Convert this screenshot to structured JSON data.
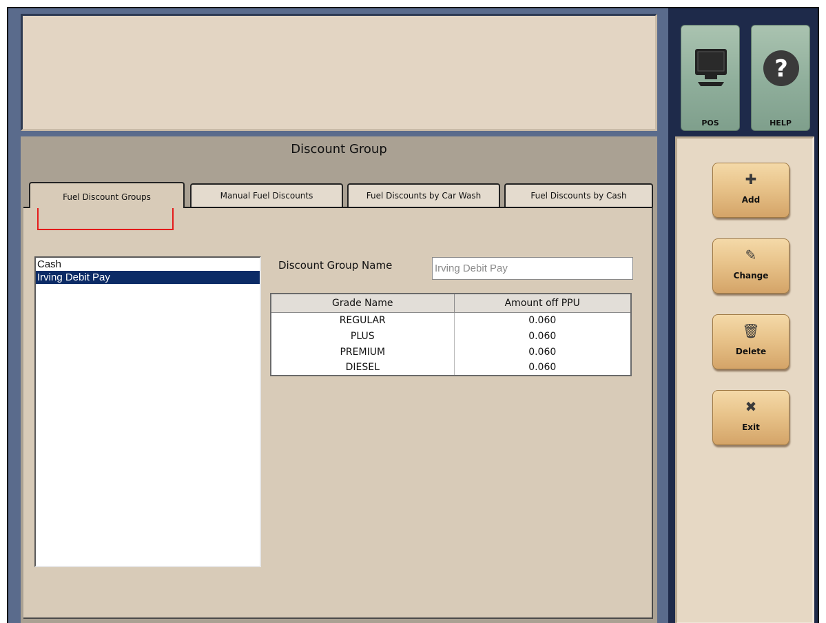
{
  "top_buttons": {
    "pos_label": "POS",
    "help_label": "HELP"
  },
  "page_title": "Discount Group",
  "tabs": [
    {
      "label": "Fuel Discount Groups",
      "active": true
    },
    {
      "label": "Manual Fuel Discounts",
      "active": false
    },
    {
      "label": "Fuel Discounts by Car Wash",
      "active": false
    },
    {
      "label": "Fuel Discounts by Cash",
      "active": false
    }
  ],
  "discount_groups": {
    "items": [
      "Cash",
      "Irving Debit Pay"
    ],
    "selected": "Irving Debit Pay"
  },
  "form": {
    "name_label": "Discount Group Name",
    "name_value": "Irving Debit Pay"
  },
  "grade_table": {
    "headers": [
      "Grade Name",
      "Amount off PPU"
    ],
    "rows": [
      [
        "REGULAR",
        "0.060"
      ],
      [
        "PLUS",
        "0.060"
      ],
      [
        "PREMIUM",
        "0.060"
      ],
      [
        "DIESEL",
        "0.060"
      ]
    ]
  },
  "actions": {
    "add_label": "Add",
    "change_label": "Change",
    "delete_label": "Delete",
    "exit_label": "Exit"
  },
  "icons": {
    "pos": "monitor-icon",
    "help": "question-icon",
    "add": "plus-icon",
    "change": "edit-icon",
    "delete": "trash-icon",
    "exit": "close-circle-icon"
  },
  "colors": {
    "highlight": "#e41b1b",
    "selection": "#0c2b66"
  }
}
